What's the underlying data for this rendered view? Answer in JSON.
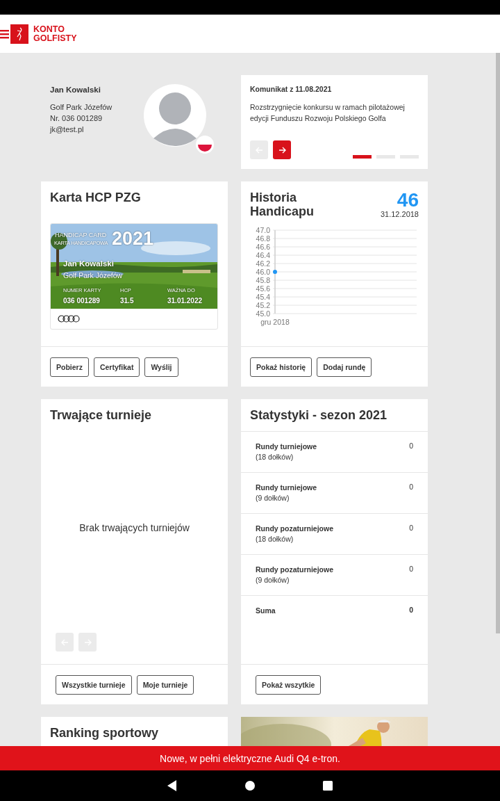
{
  "header": {
    "logo_text": [
      "KONTO",
      "GOLFISTY"
    ]
  },
  "profile": {
    "name": "Jan Kowalski",
    "club": "Golf Park Józefów",
    "number": "Nr. 036 001289",
    "email": "jk@test.pl"
  },
  "notice": {
    "title": "Komunikat z 11.08.2021",
    "text": "Rozstrzygnięcie konkursu w ramach pilotażowej edycji Funduszu Rozwoju Polskiego Golfa",
    "prev_disabled": true,
    "next_disabled": false,
    "pages": [
      {
        "selected": true
      },
      {
        "selected": false
      },
      {
        "selected": false
      }
    ]
  },
  "hcp_card": {
    "title": "Karta HCP PZG",
    "card": {
      "heading_1": "HANDICAP CARD",
      "heading_2": "KARTA HANDICAPOWA",
      "year": "2021",
      "name": "Jan Kowalski",
      "club": "Golf Park Józefów",
      "fields": [
        {
          "label": "NUMER KARTY",
          "value": "036 001289"
        },
        {
          "label": "HCP",
          "value": "31.5"
        },
        {
          "label": "WAŻNA DO",
          "value": "31.01.2022"
        }
      ]
    },
    "buttons": [
      "Pobierz",
      "Certyfikat",
      "Wyślij"
    ]
  },
  "history": {
    "title": "Historia Handicapu",
    "value": "46",
    "date": "31.12.2018",
    "chart_data": {
      "type": "line",
      "grid": true,
      "categories": [
        "gru 2018"
      ],
      "series": [
        {
          "color": "#2196f3",
          "marker": true,
          "values": [
            46.0
          ]
        }
      ],
      "ylim": [
        45.0,
        47.0
      ],
      "yticks": [
        {
          "value": 47.0,
          "label": "47.0"
        },
        {
          "value": 46.8,
          "label": "46.8"
        },
        {
          "value": 46.6,
          "label": "46.6"
        },
        {
          "value": 46.4,
          "label": "46.4"
        },
        {
          "value": 46.2,
          "label": "46.2"
        },
        {
          "value": 46.0,
          "label": "46.0"
        },
        {
          "value": 45.8,
          "label": "45.8"
        },
        {
          "value": 45.6,
          "label": "45.6"
        },
        {
          "value": 45.4,
          "label": "45.4"
        },
        {
          "value": 45.2,
          "label": "45.2"
        },
        {
          "value": 45.0,
          "label": "45.0"
        }
      ]
    },
    "buttons": [
      "Pokaż historię",
      "Dodaj rundę"
    ]
  },
  "tournaments": {
    "title": "Trwające turnieje",
    "empty_text": "Brak trwających turniejów",
    "prev_disabled": true,
    "next_disabled": true,
    "buttons": [
      "Wszystkie turnieje",
      "Moje turnieje"
    ]
  },
  "stats": {
    "title": "Statystyki - sezon 2021",
    "rows": [
      {
        "label": "Rundy turniejowe",
        "sublabel": "(18 dołków)",
        "value": "0",
        "total": false
      },
      {
        "label": "Rundy turniejowe",
        "sublabel": "(9 dołków)",
        "value": "0",
        "total": false
      },
      {
        "label": "Rundy pozaturniejowe",
        "sublabel": "(18 dołków)",
        "value": "0",
        "total": false
      },
      {
        "label": "Rundy pozaturniejowe",
        "sublabel": "(9 dołków)",
        "value": "0",
        "total": false
      },
      {
        "label": "Suma",
        "value": "0",
        "total": true
      }
    ],
    "buttons": [
      "Pokaż wszytkie"
    ]
  },
  "ranking": {
    "title": "Ranking sportowy"
  },
  "banner": {
    "text": "Nowe, w pełni elektryczne Audi Q4 e-tron."
  }
}
